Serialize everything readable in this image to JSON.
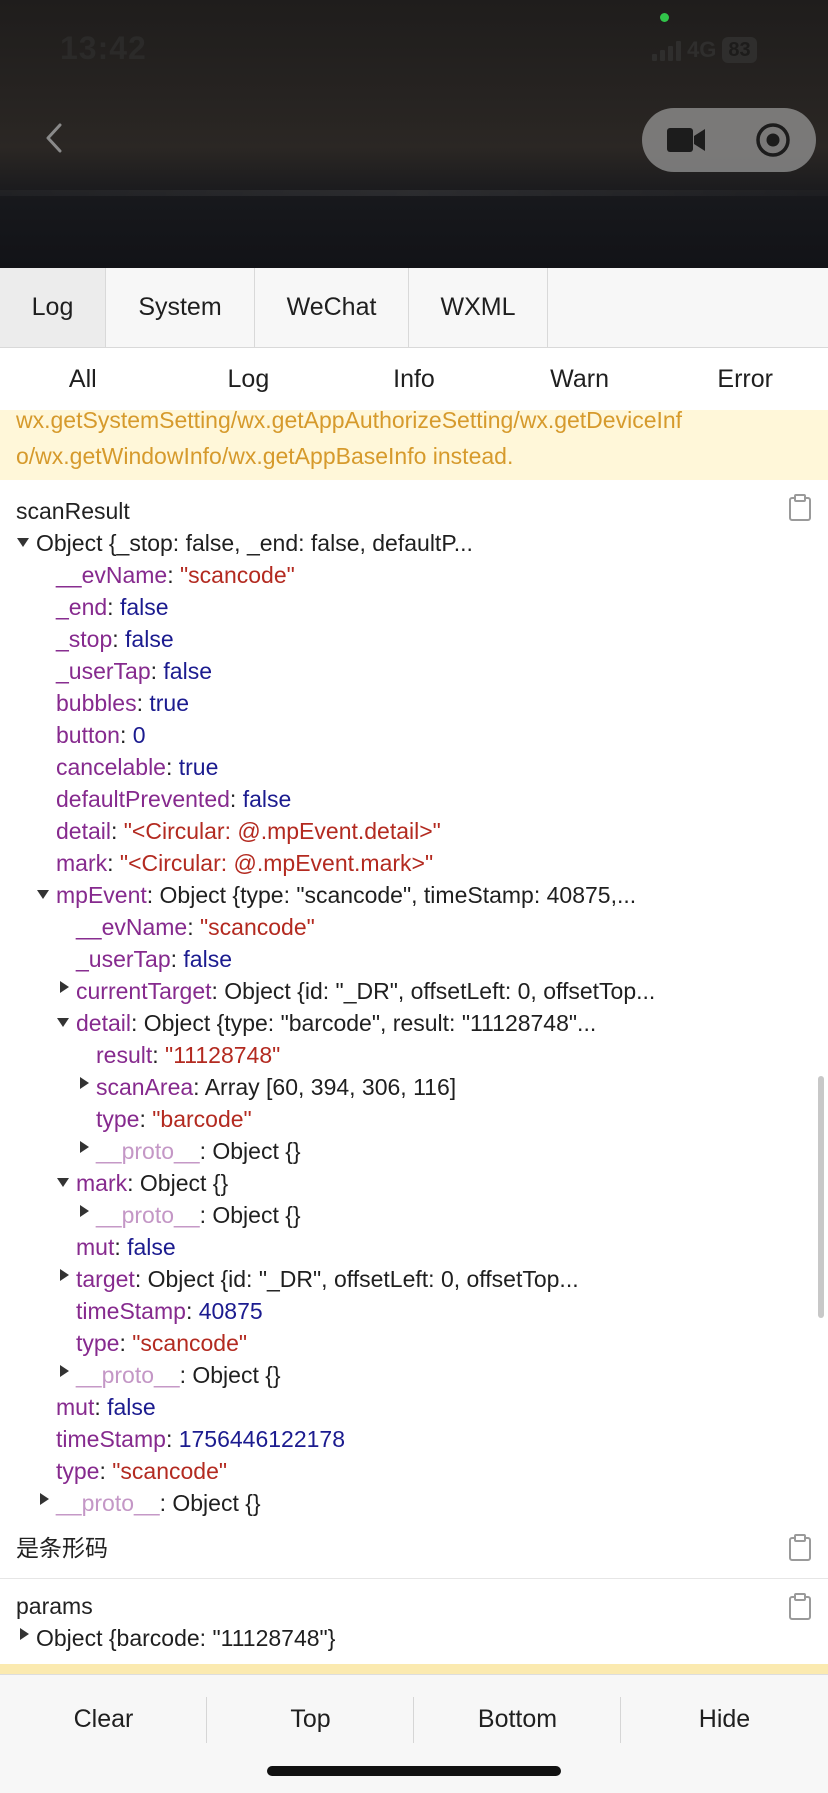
{
  "status_bar": {
    "time": "13:42",
    "network": "4G",
    "battery": "83"
  },
  "nav": {
    "back_icon": "chevron-left-icon",
    "capsule_icons": [
      "video-camera-icon",
      "record-icon"
    ]
  },
  "panel_tabs": [
    "Log",
    "System",
    "WeChat",
    "WXML"
  ],
  "filters": [
    "All",
    "Log",
    "Info",
    "Warn",
    "Error"
  ],
  "warning": {
    "line1": "wx.getSystemSetting/wx.getAppAuthorizeSetting/wx.getDeviceInf",
    "line2": "o/wx.getWindowInfo/wx.getAppBaseInfo instead."
  },
  "entries": {
    "scan": {
      "label": "scanResult",
      "summary": "Object {_stop: false, _end: false, defaultP...",
      "rows": [
        {
          "key": "__evName",
          "val": "\"scancode\""
        },
        {
          "key": "_end",
          "val": "false"
        },
        {
          "key": "_stop",
          "val": "false"
        },
        {
          "key": "_userTap",
          "val": "false"
        },
        {
          "key": "bubbles",
          "val": "true"
        },
        {
          "key": "button",
          "val": "0"
        },
        {
          "key": "cancelable",
          "val": "true"
        },
        {
          "key": "defaultPrevented",
          "val": "false"
        },
        {
          "key": "detail",
          "val": "\"<Circular: @.mpEvent.detail>\""
        },
        {
          "key": "mark",
          "val": "\"<Circular: @.mpEvent.mark>\""
        },
        {
          "key": "mpEvent",
          "val": "Object {type: \"scancode\", timeStamp: 40875,..."
        },
        {
          "key": "__evName",
          "val": "\"scancode\""
        },
        {
          "key": "_userTap",
          "val": "false"
        },
        {
          "key": "currentTarget",
          "val": "Object {id: \"_DR\", offsetLeft: 0, offsetTop..."
        },
        {
          "key": "detail",
          "val": "Object {type: \"barcode\", result: \"11128748\"..."
        },
        {
          "key": "result",
          "val": "\"11128748\""
        },
        {
          "key": "scanArea",
          "val": "Array [60, 394, 306, 116]"
        },
        {
          "key": "type",
          "val": "\"barcode\""
        },
        {
          "key": "__proto__",
          "val": "Object {}"
        },
        {
          "key": "mark",
          "val": "Object {}"
        },
        {
          "key": "__proto__",
          "val": "Object {}"
        },
        {
          "key": "mut",
          "val": "false"
        },
        {
          "key": "target",
          "val": "Object {id: \"_DR\", offsetLeft: 0, offsetTop..."
        },
        {
          "key": "timeStamp",
          "val": "40875"
        },
        {
          "key": "type",
          "val": "\"scancode\""
        },
        {
          "key": "__proto__",
          "val": "Object {}"
        },
        {
          "key": "mut",
          "val": "false"
        },
        {
          "key": "timeStamp",
          "val": "1756446122178"
        },
        {
          "key": "type",
          "val": "\"scancode\""
        },
        {
          "key": "__proto__",
          "val": "Object {}"
        }
      ]
    },
    "barcode_msg": {
      "text": "是条形码"
    },
    "params": {
      "label": "params",
      "summary": "Object {barcode: \"11128748\"}"
    }
  },
  "toolbar": [
    "Clear",
    "Top",
    "Bottom",
    "Hide"
  ]
}
